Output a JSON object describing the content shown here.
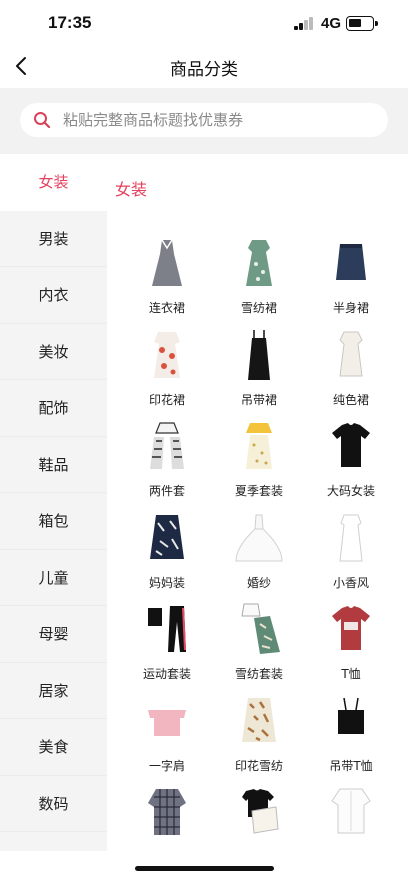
{
  "status_bar": {
    "time": "17:35",
    "network": "4G",
    "signal_icon": "signal-bars-icon",
    "battery_icon": "battery-icon"
  },
  "nav": {
    "title": "商品分类",
    "back_icon": "chevron-left-icon"
  },
  "search": {
    "placeholder": "粘贴完整商品标题找优惠券",
    "value": "",
    "icon": "search-icon"
  },
  "sidebar": {
    "items": [
      {
        "label": "女装",
        "active": true
      },
      {
        "label": "男装",
        "active": false
      },
      {
        "label": "内衣",
        "active": false
      },
      {
        "label": "美妆",
        "active": false
      },
      {
        "label": "配饰",
        "active": false
      },
      {
        "label": "鞋品",
        "active": false
      },
      {
        "label": "箱包",
        "active": false
      },
      {
        "label": "儿童",
        "active": false
      },
      {
        "label": "母婴",
        "active": false
      },
      {
        "label": "居家",
        "active": false
      },
      {
        "label": "美食",
        "active": false
      },
      {
        "label": "数码",
        "active": false
      }
    ]
  },
  "content": {
    "section_title": "女装",
    "categories": [
      {
        "label": "连衣裙",
        "icon": "dress-icon"
      },
      {
        "label": "雪纺裙",
        "icon": "chiffon-dress-icon"
      },
      {
        "label": "半身裙",
        "icon": "skirt-icon"
      },
      {
        "label": "印花裙",
        "icon": "printed-dress-icon"
      },
      {
        "label": "吊带裙",
        "icon": "slip-dress-icon"
      },
      {
        "label": "纯色裙",
        "icon": "solid-dress-icon"
      },
      {
        "label": "两件套",
        "icon": "two-piece-set-icon"
      },
      {
        "label": "夏季套装",
        "icon": "summer-set-icon"
      },
      {
        "label": "大码女装",
        "icon": "tshirt-icon"
      },
      {
        "label": "妈妈装",
        "icon": "mom-wear-icon"
      },
      {
        "label": "婚纱",
        "icon": "wedding-dress-icon"
      },
      {
        "label": "小香风",
        "icon": "chanel-style-icon"
      },
      {
        "label": "运动套装",
        "icon": "sport-set-icon"
      },
      {
        "label": "雪纺套装",
        "icon": "chiffon-set-icon"
      },
      {
        "label": "T恤",
        "icon": "tshirt-red-icon"
      },
      {
        "label": "一字肩",
        "icon": "off-shoulder-top-icon"
      },
      {
        "label": "印花雪纺",
        "icon": "printed-chiffon-icon"
      },
      {
        "label": "吊带T恤",
        "icon": "camisole-icon"
      },
      {
        "label": "",
        "icon": "plaid-blouse-icon"
      },
      {
        "label": "",
        "icon": "tee-set-icon"
      },
      {
        "label": "",
        "icon": "white-blouse-icon"
      }
    ]
  },
  "colors": {
    "accent": "#e5405e",
    "sidebar_bg": "#f4f4f4",
    "search_bg": "#f2f2f2"
  }
}
